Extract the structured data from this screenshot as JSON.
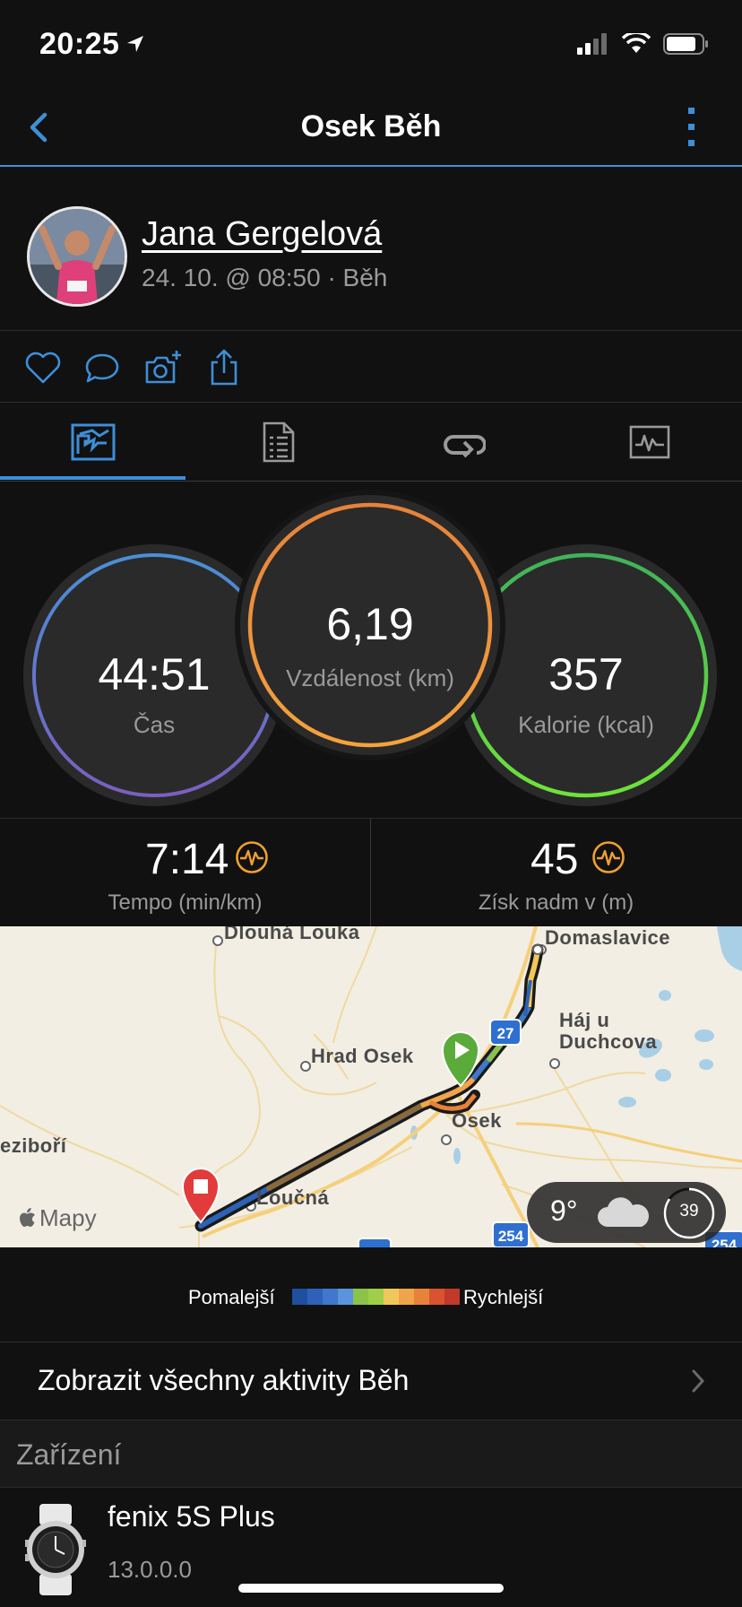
{
  "status_bar": {
    "time": "20:25"
  },
  "nav": {
    "title": "Osek Běh"
  },
  "profile": {
    "name": "Jana Gergelová",
    "meta": "24. 10. @ 08:50 · Běh"
  },
  "summary": {
    "time": {
      "value": "44:51",
      "label": "Čas"
    },
    "distance": {
      "value": "6,19",
      "label": "Vzdálenost (km)"
    },
    "calories": {
      "value": "357",
      "label": "Kalorie (kcal)"
    }
  },
  "stats": {
    "pace": {
      "value": "7:14",
      "label": "Tempo (min/km)"
    },
    "elevation": {
      "value": "45",
      "label": "Získ nadm v (m)"
    }
  },
  "map": {
    "places": [
      "Dlouhá Louka",
      "Domaslavice",
      "Hrad Osek",
      "Háj u",
      "Duchcova",
      "Osek",
      "eziboří",
      "Loučná"
    ],
    "roads": [
      "27",
      "254",
      "254"
    ],
    "attribution": "Mapy",
    "weather": {
      "temp": "9°",
      "aqi": "39"
    }
  },
  "legend": {
    "slower": "Pomalejší",
    "faster": "Rychlejší",
    "colors": [
      "#1f4f9e",
      "#2d62b8",
      "#3f78cc",
      "#5a94dd",
      "#8bc34a",
      "#9fcf4a",
      "#f2c75a",
      "#f0a54a",
      "#e8823a",
      "#d9532e",
      "#c0392b"
    ]
  },
  "all_activities": {
    "label": "Zobrazit všechny aktivity Běh"
  },
  "device_section": {
    "header": "Zařízení",
    "name": "fenix 5S Plus",
    "version": "13.0.0.0"
  }
}
